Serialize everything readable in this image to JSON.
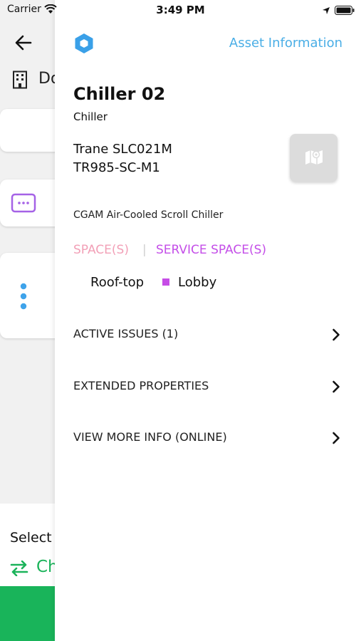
{
  "status_bar": {
    "carrier": "Carrier",
    "time": "3:49 PM"
  },
  "background": {
    "title_fragment": "Do",
    "select_label": "Select",
    "action_fragment": "Ch"
  },
  "drawer": {
    "header_title": "Asset Information",
    "asset_name": "Chiller 02",
    "asset_type": "Chiller",
    "model": "Trane SLC021M",
    "serial": "TR985-SC-M1",
    "description": "CGAM Air-Cooled Scroll Chiller",
    "tabs": {
      "space": "SPACE(S)",
      "separator": "|",
      "service_space": "SERVICE SPACE(S)"
    },
    "spaces": {
      "space": "Roof-top",
      "service_space": "Lobby"
    },
    "rows": [
      {
        "label": "ACTIVE ISSUES (1)"
      },
      {
        "label": "EXTENDED PROPERTIES"
      },
      {
        "label": "VIEW MORE INFO (ONLINE)"
      }
    ]
  },
  "colors": {
    "accent_blue": "#4aaee6",
    "space_tab_pink": "#f2a0b7",
    "service_space_purple": "#c44ee8",
    "green": "#19b45a"
  },
  "icons": [
    "wifi-icon",
    "location-arrow-icon",
    "battery-icon",
    "back-arrow-icon",
    "building-icon",
    "ticket-icon",
    "more-vertical-icon",
    "swap-arrows-icon",
    "hexagon-logo-icon",
    "map-icon",
    "chevron-right-icon"
  ]
}
